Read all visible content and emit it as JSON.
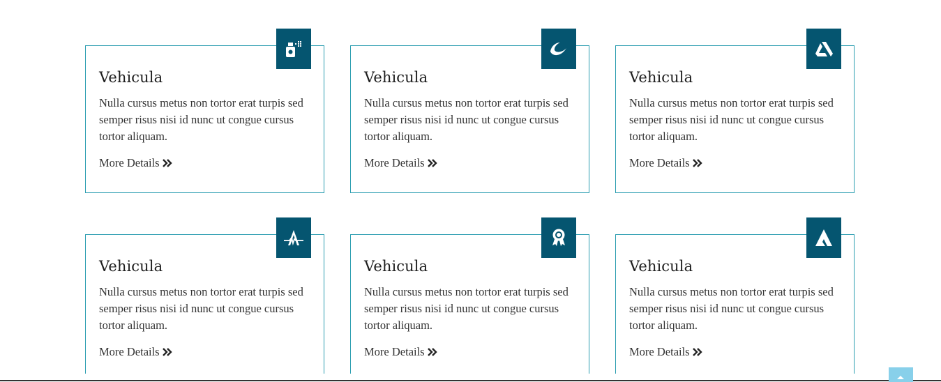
{
  "cards": [
    {
      "title": "Vehicula",
      "text": "Nulla cursus metus non tortor erat turpis sed semper risus nisi id nunc ut congue cursus tortor aliquam.",
      "link": "More Details",
      "icon": "spray-bottle-icon"
    },
    {
      "title": "Vehicula",
      "text": "Nulla cursus metus non tortor erat turpis sed semper risus nisi id nunc ut congue cursus tortor aliquam.",
      "link": "More Details",
      "icon": "wave-swirl-icon"
    },
    {
      "title": "Vehicula",
      "text": "Nulla cursus metus non tortor erat turpis sed semper risus nisi id nunc ut congue cursus tortor aliquam.",
      "link": "More Details",
      "icon": "artstation-icon"
    },
    {
      "title": "Vehicula",
      "text": "Nulla cursus metus non tortor erat turpis sed semper risus nisi id nunc ut congue cursus tortor aliquam.",
      "link": "More Details",
      "icon": "letter-a-heartbeat-icon"
    },
    {
      "title": "Vehicula",
      "text": "Nulla cursus metus non tortor erat turpis sed semper risus nisi id nunc ut congue cursus tortor aliquam.",
      "link": "More Details",
      "icon": "award-ribbon-icon"
    },
    {
      "title": "Vehicula",
      "text": "Nulla cursus metus non tortor erat turpis sed semper risus nisi id nunc ut congue cursus tortor aliquam.",
      "link": "More Details",
      "icon": "affinity-triangle-icon"
    }
  ],
  "colors": {
    "icon_bg": "#055570",
    "card_border": "#2a9db0",
    "scroll_top_bg": "#88d0ea"
  },
  "scroll_top": {
    "icon": "chevron-up-icon"
  }
}
